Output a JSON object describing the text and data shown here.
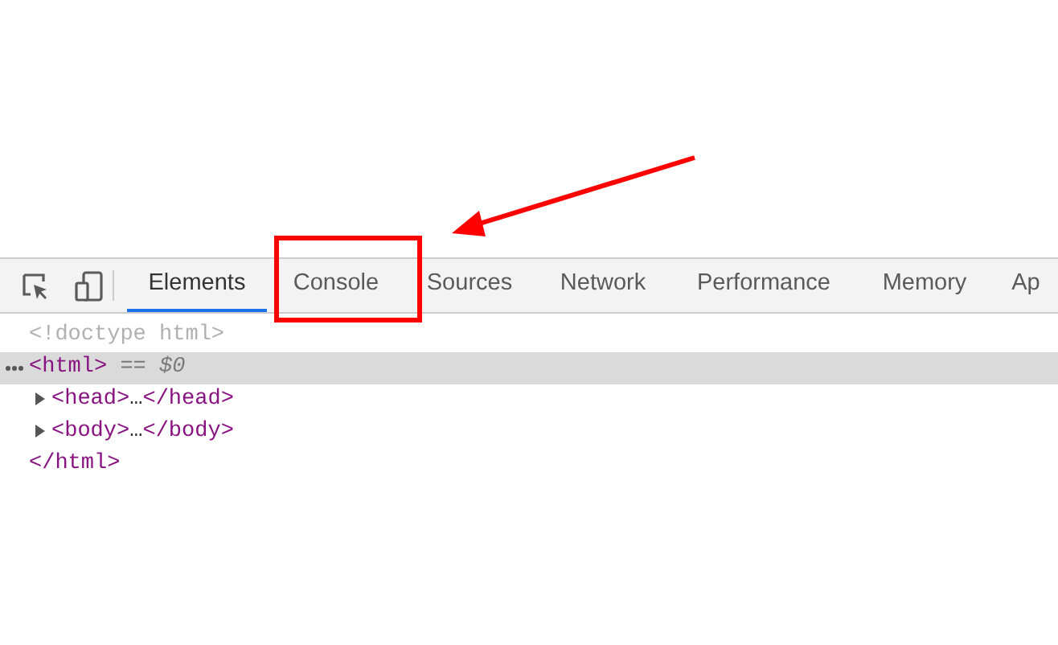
{
  "tabs": [
    {
      "label": "Elements",
      "selected": true
    },
    {
      "label": "Console",
      "selected": false
    },
    {
      "label": "Sources",
      "selected": false
    },
    {
      "label": "Network",
      "selected": false
    },
    {
      "label": "Performance",
      "selected": false
    },
    {
      "label": "Memory",
      "selected": false
    },
    {
      "label": "Ap",
      "selected": false
    }
  ],
  "tree": {
    "doctype": "<!doctype html>",
    "root": {
      "open": "<html>",
      "marker": "== $0",
      "selected": true,
      "close": "</html>",
      "children": [
        {
          "open": "<head>",
          "ellipsis": "…",
          "close": "</head>",
          "expanded": false
        },
        {
          "open": "<body>",
          "ellipsis": "…",
          "close": "</body>",
          "expanded": false
        }
      ]
    }
  }
}
